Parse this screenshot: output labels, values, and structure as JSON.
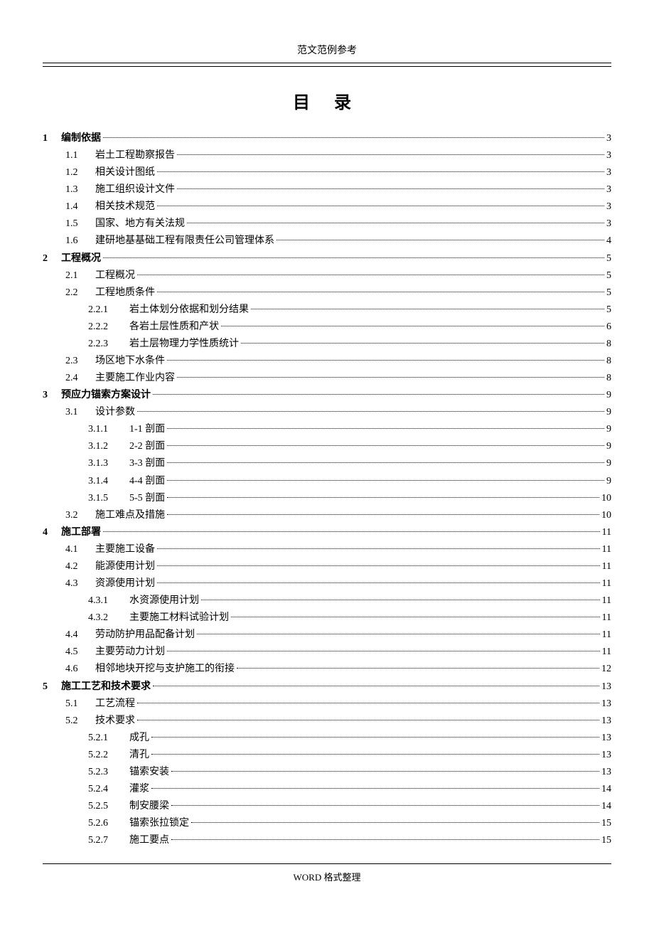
{
  "header": "范文范例参考",
  "title": "目  录",
  "footer": "WORD 格式整理",
  "toc": [
    {
      "level": 1,
      "num": "1",
      "label": "编制依据",
      "page": "3"
    },
    {
      "level": 2,
      "num": "1.1",
      "label": "岩土工程勘察报告",
      "page": "3"
    },
    {
      "level": 2,
      "num": "1.2",
      "label": "相关设计图纸",
      "page": "3"
    },
    {
      "level": 2,
      "num": "1.3",
      "label": "施工组织设计文件",
      "page": "3"
    },
    {
      "level": 2,
      "num": "1.4",
      "label": "相关技术规范",
      "page": "3"
    },
    {
      "level": 2,
      "num": "1.5",
      "label": "国家、地方有关法规",
      "page": "3"
    },
    {
      "level": 2,
      "num": "1.6",
      "label": "建研地基基础工程有限责任公司管理体系",
      "page": "4"
    },
    {
      "level": 1,
      "num": "2",
      "label": "工程概况",
      "page": "5"
    },
    {
      "level": 2,
      "num": "2.1",
      "label": "工程概况",
      "page": "5"
    },
    {
      "level": 2,
      "num": "2.2",
      "label": "工程地质条件",
      "page": "5"
    },
    {
      "level": 3,
      "num": "2.2.1",
      "label": "岩土体划分依据和划分结果",
      "page": "5"
    },
    {
      "level": 3,
      "num": "2.2.2",
      "label": "各岩土层性质和产状",
      "page": "6"
    },
    {
      "level": 3,
      "num": "2.2.3",
      "label": "岩土层物理力学性质统计",
      "page": "8"
    },
    {
      "level": 2,
      "num": "2.3",
      "label": "场区地下水条件",
      "page": "8"
    },
    {
      "level": 2,
      "num": "2.4",
      "label": "主要施工作业内容",
      "page": "8"
    },
    {
      "level": 1,
      "num": "3",
      "label": "预应力锚索方案设计",
      "page": "9"
    },
    {
      "level": 2,
      "num": "3.1",
      "label": "设计参数",
      "page": "9"
    },
    {
      "level": 3,
      "num": "3.1.1",
      "label": "1-1 剖面",
      "page": "9"
    },
    {
      "level": 3,
      "num": "3.1.2",
      "label": "2-2 剖面",
      "page": "9"
    },
    {
      "level": 3,
      "num": "3.1.3",
      "label": "3-3 剖面",
      "page": "9"
    },
    {
      "level": 3,
      "num": "3.1.4",
      "label": "4-4 剖面",
      "page": "9"
    },
    {
      "level": 3,
      "num": "3.1.5",
      "label": "5-5 剖面",
      "page": "10"
    },
    {
      "level": 2,
      "num": "3.2",
      "label": "施工难点及措施",
      "page": "10"
    },
    {
      "level": 1,
      "num": "4",
      "label": "施工部署",
      "page": "11"
    },
    {
      "level": 2,
      "num": "4.1",
      "label": "主要施工设备",
      "page": "11"
    },
    {
      "level": 2,
      "num": "4.2",
      "label": "能源使用计划",
      "page": "11"
    },
    {
      "level": 2,
      "num": "4.3",
      "label": "资源使用计划",
      "page": "11"
    },
    {
      "level": 3,
      "num": "4.3.1",
      "label": "水资源使用计划",
      "page": "11"
    },
    {
      "level": 3,
      "num": "4.3.2",
      "label": "主要施工材料试验计划",
      "page": "11"
    },
    {
      "level": 2,
      "num": "4.4",
      "label": "劳动防护用品配备计划",
      "page": "11"
    },
    {
      "level": 2,
      "num": "4.5",
      "label": "主要劳动力计划",
      "page": "11"
    },
    {
      "level": 2,
      "num": "4.6",
      "label": "相邻地块开挖与支护施工的衔接",
      "page": "12"
    },
    {
      "level": 1,
      "num": "5",
      "label": "施工工艺和技术要求",
      "page": "13"
    },
    {
      "level": 2,
      "num": "5.1",
      "label": "工艺流程",
      "page": "13"
    },
    {
      "level": 2,
      "num": "5.2",
      "label": "技术要求",
      "page": "13"
    },
    {
      "level": 3,
      "num": "5.2.1",
      "label": "成孔",
      "page": "13"
    },
    {
      "level": 3,
      "num": "5.2.2",
      "label": "清孔",
      "page": "13"
    },
    {
      "level": 3,
      "num": "5.2.3",
      "label": "锚索安装",
      "page": "13"
    },
    {
      "level": 3,
      "num": "5.2.4",
      "label": "灌浆",
      "page": "14"
    },
    {
      "level": 3,
      "num": "5.2.5",
      "label": "制安腰梁",
      "page": "14"
    },
    {
      "level": 3,
      "num": "5.2.6",
      "label": "锚索张拉锁定",
      "page": "15"
    },
    {
      "level": 3,
      "num": "5.2.7",
      "label": "施工要点",
      "page": "15"
    }
  ]
}
